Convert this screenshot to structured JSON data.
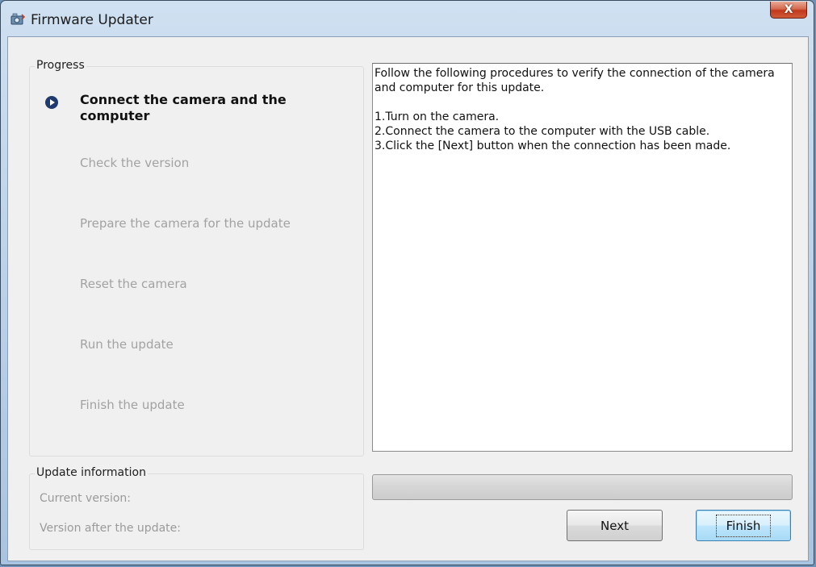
{
  "window": {
    "title": "Firmware Updater",
    "close_label": "X"
  },
  "progress": {
    "group_title": "Progress",
    "steps": [
      {
        "label": "Connect the camera and the computer",
        "active": true
      },
      {
        "label": "Check the version",
        "active": false
      },
      {
        "label": "Prepare the camera for the update",
        "active": false
      },
      {
        "label": "Reset the camera",
        "active": false
      },
      {
        "label": "Run the update",
        "active": false
      },
      {
        "label": "Finish the update",
        "active": false
      }
    ]
  },
  "update_info": {
    "group_title": "Update information",
    "current_version_label": "Current version:",
    "after_version_label": "Version after the update:"
  },
  "instructions": {
    "intro": "Follow the following procedures to verify the connection of the camera and computer for this update.",
    "items": [
      "1.Turn on the camera.",
      "2.Connect the camera to the computer with the USB cable.",
      "3.Click the [Next] button when the connection has been made."
    ]
  },
  "progress_bar": {
    "value": 0
  },
  "buttons": {
    "next_label": "Next",
    "finish_label": "Finish"
  },
  "colors": {
    "active_step": "#111111",
    "inactive_step": "#a2a2a2",
    "marker": "#1f3a6e"
  }
}
